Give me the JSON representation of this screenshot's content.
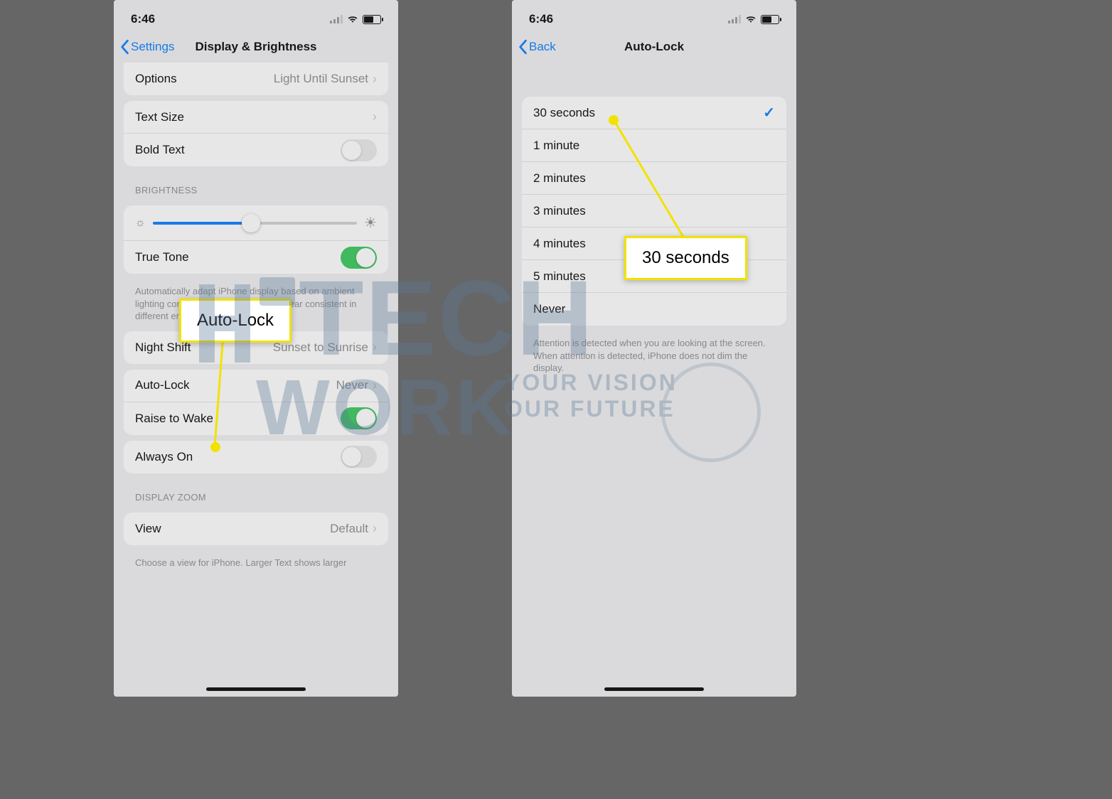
{
  "status": {
    "time": "6:46"
  },
  "left": {
    "back": "Settings",
    "title": "Display & Brightness",
    "options_label": "Options",
    "options_value": "Light Until Sunset",
    "text_size": "Text Size",
    "bold_text": "Bold Text",
    "brightness_header": "BRIGHTNESS",
    "true_tone": "True Tone",
    "true_tone_desc": "Automatically adapt iPhone display based on ambient lighting conditions to make colors appear consistent in different environments.",
    "night_shift": "Night Shift",
    "night_shift_value": "Sunset to Sunrise",
    "auto_lock": "Auto-Lock",
    "auto_lock_value": "Never",
    "raise_to_wake": "Raise to Wake",
    "always_on": "Always On",
    "display_zoom_header": "DISPLAY ZOOM",
    "view": "View",
    "view_value": "Default",
    "view_desc": "Choose a view for iPhone. Larger Text shows larger"
  },
  "right": {
    "back": "Back",
    "title": "Auto-Lock",
    "options": [
      "30 seconds",
      "1 minute",
      "2 minutes",
      "3 minutes",
      "4 minutes",
      "5 minutes",
      "Never"
    ],
    "selected_index": 0,
    "attention_desc": "Attention is detected when you are looking at the screen. When attention is detected, iPhone does not dim the display."
  },
  "callouts": {
    "left_label": "Auto-Lock",
    "right_label": "30 seconds"
  },
  "watermark": {
    "line1": "TECH",
    "line2": "WORK",
    "sub1": "YOUR VISION",
    "sub2": "OUR FUTURE"
  }
}
